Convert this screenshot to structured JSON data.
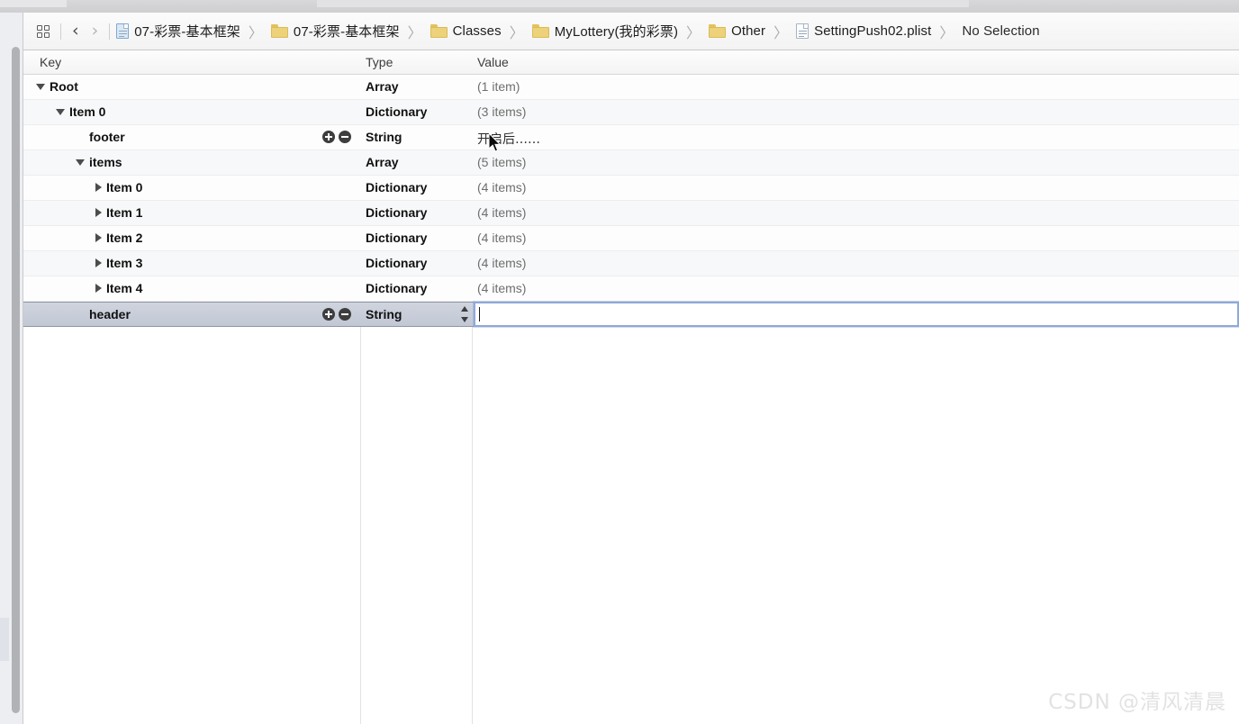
{
  "window": {
    "app": "Xcode",
    "top_strip_visible": true
  },
  "jumpbar": {
    "related_items_icon": "grid-icon",
    "back_label": "‹",
    "forward_label": "›",
    "separator": "〉",
    "crumbs": [
      {
        "icon": "project-document-icon",
        "label": "07-彩票-基本框架"
      },
      {
        "icon": "folder-icon",
        "label": "07-彩票-基本框架"
      },
      {
        "icon": "folder-icon",
        "label": "Classes"
      },
      {
        "icon": "folder-icon",
        "label": "MyLottery(我的彩票)"
      },
      {
        "icon": "folder-icon",
        "label": "Other"
      },
      {
        "icon": "plist-document-icon",
        "label": "SettingPush02.plist"
      },
      {
        "icon": "none",
        "label": "No Selection"
      }
    ]
  },
  "table": {
    "columns": [
      "Key",
      "Type",
      "Value"
    ],
    "rows": [
      {
        "key": "Root",
        "indent": 0,
        "disclosure": "open",
        "type": "Array",
        "value": "(1 item)",
        "selected": false,
        "has_add_remove": false,
        "has_stepper": false,
        "editing": false
      },
      {
        "key": "Item 0",
        "indent": 1,
        "disclosure": "open",
        "type": "Dictionary",
        "value": "(3 items)",
        "selected": false,
        "has_add_remove": false,
        "has_stepper": false,
        "editing": false
      },
      {
        "key": "footer",
        "indent": 2,
        "disclosure": "none",
        "type": "String",
        "value": "开启后……",
        "value_cjk": true,
        "selected": false,
        "has_add_remove": true,
        "has_stepper": false,
        "editing": false
      },
      {
        "key": "items",
        "indent": 2,
        "disclosure": "open",
        "type": "Array",
        "value": "(5 items)",
        "selected": false,
        "has_add_remove": false,
        "has_stepper": false,
        "editing": false
      },
      {
        "key": "Item 0",
        "indent": 3,
        "disclosure": "closed",
        "type": "Dictionary",
        "value": "(4 items)",
        "selected": false,
        "has_add_remove": false,
        "has_stepper": false,
        "editing": false
      },
      {
        "key": "Item 1",
        "indent": 3,
        "disclosure": "closed",
        "type": "Dictionary",
        "value": "(4 items)",
        "selected": false,
        "has_add_remove": false,
        "has_stepper": false,
        "editing": false
      },
      {
        "key": "Item 2",
        "indent": 3,
        "disclosure": "closed",
        "type": "Dictionary",
        "value": "(4 items)",
        "selected": false,
        "has_add_remove": false,
        "has_stepper": false,
        "editing": false
      },
      {
        "key": "Item 3",
        "indent": 3,
        "disclosure": "closed",
        "type": "Dictionary",
        "value": "(4 items)",
        "selected": false,
        "has_add_remove": false,
        "has_stepper": false,
        "editing": false
      },
      {
        "key": "Item 4",
        "indent": 3,
        "disclosure": "closed",
        "type": "Dictionary",
        "value": "(4 items)",
        "selected": false,
        "has_add_remove": false,
        "has_stepper": false,
        "editing": false
      },
      {
        "key": "header",
        "indent": 2,
        "disclosure": "none",
        "type": "String",
        "value": "",
        "selected": true,
        "has_add_remove": true,
        "has_stepper": true,
        "editing": true
      }
    ]
  },
  "edit_field": {
    "value": "",
    "placeholder": ""
  },
  "watermark": {
    "text": "CSDN @清风清晨"
  },
  "colors": {
    "selection": "#c2c8d4",
    "focus_border": "#8fa9d8",
    "folder": "#edd27a",
    "value_text": "#6e6e6e"
  }
}
